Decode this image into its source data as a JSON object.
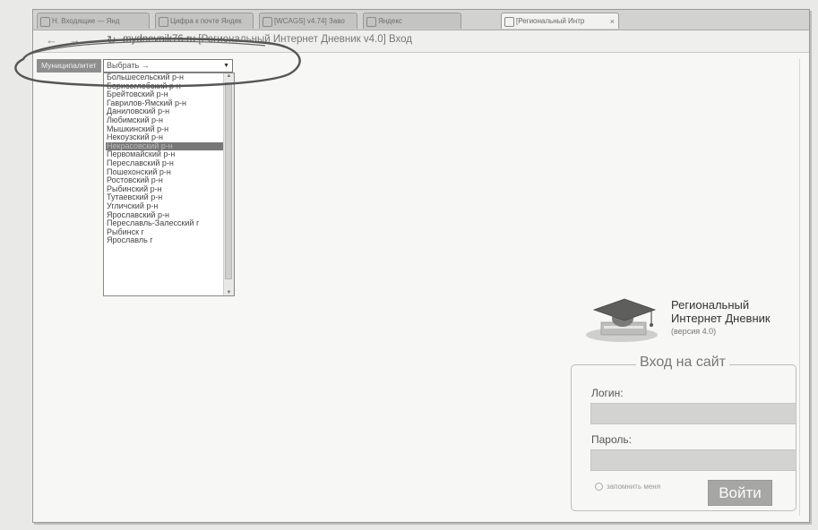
{
  "tabs": [
    {
      "label": "Н. Входящие — Янд"
    },
    {
      "label": "Цифра к почте Яндек"
    },
    {
      "label": "[WCAGS] v4.74] Заво"
    },
    {
      "label": "Яндекс"
    },
    {
      "label": "[Региональный Интр"
    }
  ],
  "address": {
    "host": "mydnevnik76.ru",
    "page_title": "[Региональный Интернет Дневник v4.0] Вход"
  },
  "region": {
    "label": "Муниципалитет",
    "selected": "Выбрать →",
    "options": [
      "Большесельский р-н",
      "Борисоглебский р-н",
      "Брейтовский р-н",
      "Гаврилов-Ямский р-н",
      "Даниловский р-н",
      "Любимский р-н",
      "Мышкинский р-н",
      "Некоузский р-н",
      "Некрасовский р-н",
      "Первомайский р-н",
      "Переславский р-н",
      "Пошехонский р-н",
      "Ростовский р-н",
      "Рыбинский р-н",
      "Тутаевский р-н",
      "Угличский р-н",
      "Ярославский р-н",
      "Переславль-Залесский г",
      "Рыбинск г",
      "Ярославль г"
    ],
    "highlighted_index": 8
  },
  "brand": {
    "line1": "Региональный",
    "line2": "Интернет Дневник",
    "version": "(версия 4.0)"
  },
  "login": {
    "title": "Вход на сайт",
    "login_label": "Логин:",
    "password_label": "Пароль:",
    "remember_label": "запомнить меня",
    "submit_label": "Войти"
  },
  "icons": {
    "tab": "page-icon",
    "close": "close-icon",
    "back": "back-arrow-icon",
    "forward": "forward-arrow-icon",
    "reload": "reload-icon",
    "dropdown": "chevron-down-icon",
    "logo": "graduation-cap-icon"
  },
  "colors": {
    "highlight": "#777777",
    "button": "#a6a6a4",
    "field": "#d3d3d1",
    "annotation": "#555555"
  }
}
